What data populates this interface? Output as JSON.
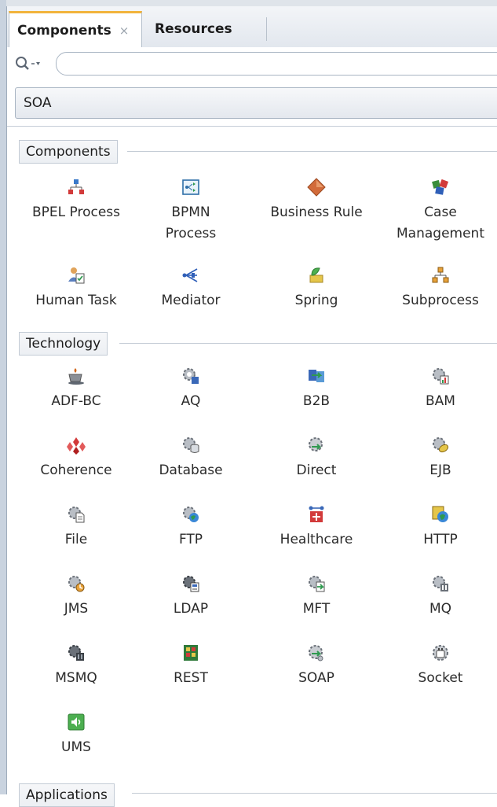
{
  "tabs": [
    {
      "label": "Components",
      "active": true,
      "close": "×"
    },
    {
      "label": "Resources",
      "active": false
    }
  ],
  "search": {
    "value": "",
    "placeholder": ""
  },
  "catalog": {
    "selected": "SOA"
  },
  "sections": [
    {
      "title": "Components",
      "items": [
        {
          "label": "BPEL Process",
          "icon": "bpel-process-icon"
        },
        {
          "label": "BPMN Process",
          "icon": "bpmn-process-icon"
        },
        {
          "label": "Business Rule",
          "icon": "business-rule-icon"
        },
        {
          "label": "Case Management",
          "icon": "case-management-icon"
        },
        {
          "label": "Human Task",
          "icon": "human-task-icon"
        },
        {
          "label": "Mediator",
          "icon": "mediator-icon"
        },
        {
          "label": "Spring",
          "icon": "spring-icon"
        },
        {
          "label": "Subprocess",
          "icon": "subprocess-icon"
        }
      ]
    },
    {
      "title": "Technology",
      "items": [
        {
          "label": "ADF-BC",
          "icon": "adf-bc-icon"
        },
        {
          "label": "AQ",
          "icon": "aq-icon"
        },
        {
          "label": "B2B",
          "icon": "b2b-icon"
        },
        {
          "label": "BAM",
          "icon": "bam-icon"
        },
        {
          "label": "Coherence",
          "icon": "coherence-icon"
        },
        {
          "label": "Database",
          "icon": "database-icon"
        },
        {
          "label": "Direct",
          "icon": "direct-icon"
        },
        {
          "label": "EJB",
          "icon": "ejb-icon"
        },
        {
          "label": "File",
          "icon": "file-icon"
        },
        {
          "label": "FTP",
          "icon": "ftp-icon"
        },
        {
          "label": "Healthcare",
          "icon": "healthcare-icon"
        },
        {
          "label": "HTTP",
          "icon": "http-icon"
        },
        {
          "label": "JMS",
          "icon": "jms-icon"
        },
        {
          "label": "LDAP",
          "icon": "ldap-icon"
        },
        {
          "label": "MFT",
          "icon": "mft-icon"
        },
        {
          "label": "MQ",
          "icon": "mq-icon"
        },
        {
          "label": "MSMQ",
          "icon": "msmq-icon"
        },
        {
          "label": "REST",
          "icon": "rest-icon"
        },
        {
          "label": "SOAP",
          "icon": "soap-icon"
        },
        {
          "label": "Socket",
          "icon": "socket-icon"
        },
        {
          "label": "UMS",
          "icon": "ums-icon"
        }
      ]
    },
    {
      "title": "Applications",
      "items": []
    }
  ],
  "colors": {
    "tab_accent": "#f2b43c",
    "panel_bg": "#ffffff",
    "border": "#b5c0cc"
  }
}
